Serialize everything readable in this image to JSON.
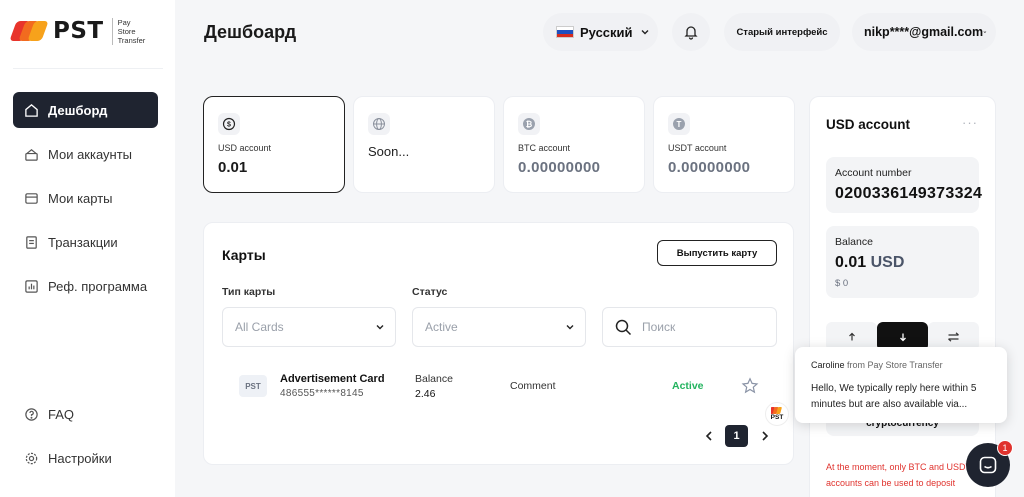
{
  "brand": {
    "name": "PST",
    "subtitle_line1": "Pay",
    "subtitle_line2": "Store",
    "subtitle_line3": "Transfer",
    "colors": [
      "#e8342b",
      "#f26b1f",
      "#f7a21b"
    ]
  },
  "sidebar": {
    "items": [
      {
        "label": "Дешборд",
        "icon": "home-icon",
        "active": true
      },
      {
        "label": "Мои аккаунты",
        "icon": "wallet-icon"
      },
      {
        "label": "Мои карты",
        "icon": "card-icon"
      },
      {
        "label": "Транзакции",
        "icon": "doc-icon"
      },
      {
        "label": "Реф. программа",
        "icon": "chart-icon"
      }
    ],
    "bottom_items": [
      {
        "label": "FAQ",
        "icon": "help-icon"
      },
      {
        "label": "Настройки",
        "icon": "settings-icon"
      }
    ]
  },
  "header": {
    "title": "Дешбоард",
    "language": "Русский",
    "old_ui_label": "Старый интерфейс",
    "user_email": "nikp****@gmail.com"
  },
  "accounts": [
    {
      "label": "USD account",
      "value": "0.01",
      "icon": "dollar-icon"
    },
    {
      "label": "",
      "value": "Soon...",
      "icon": "globe-icon"
    },
    {
      "label": "BTC account",
      "value": "0.00000000",
      "icon": "bitcoin-icon"
    },
    {
      "label": "USDT account",
      "value": "0.00000000",
      "icon": "tether-icon"
    }
  ],
  "cards_panel": {
    "title": "Карты",
    "issue_button": "Выпустить карту",
    "card_type_label": "Тип карты",
    "card_type_value": "All Cards",
    "status_label": "Статус",
    "status_value": "Active",
    "search_placeholder": "Поиск",
    "rows": [
      {
        "logo": "PST",
        "name": "Advertisement Card",
        "number": "486555******8145",
        "balance_label": "Balance",
        "balance": "2.46",
        "comment": "Comment",
        "status": "Active"
      }
    ],
    "pagination": {
      "current_page": "1"
    }
  },
  "usd_panel": {
    "title": "USD account",
    "menu": "···",
    "account_number_label": "Account number",
    "account_number": "0200336149373324",
    "balance_label": "Balance",
    "balance_value": "0.01",
    "balance_currency": "USD",
    "balance_secondary": "$ 0",
    "crypto_text": "cryptocurrency",
    "warning_line1": "At the moment, only BTC and USDT",
    "warning_line2": "accounts can be used to deposit"
  },
  "chat": {
    "agent": "Caroline",
    "from_text": "from Pay Store Transfer",
    "message": "Hello, We typically reply here within 5 minutes but are also available via...",
    "avatar_label": "PST",
    "badge_count": "1"
  }
}
